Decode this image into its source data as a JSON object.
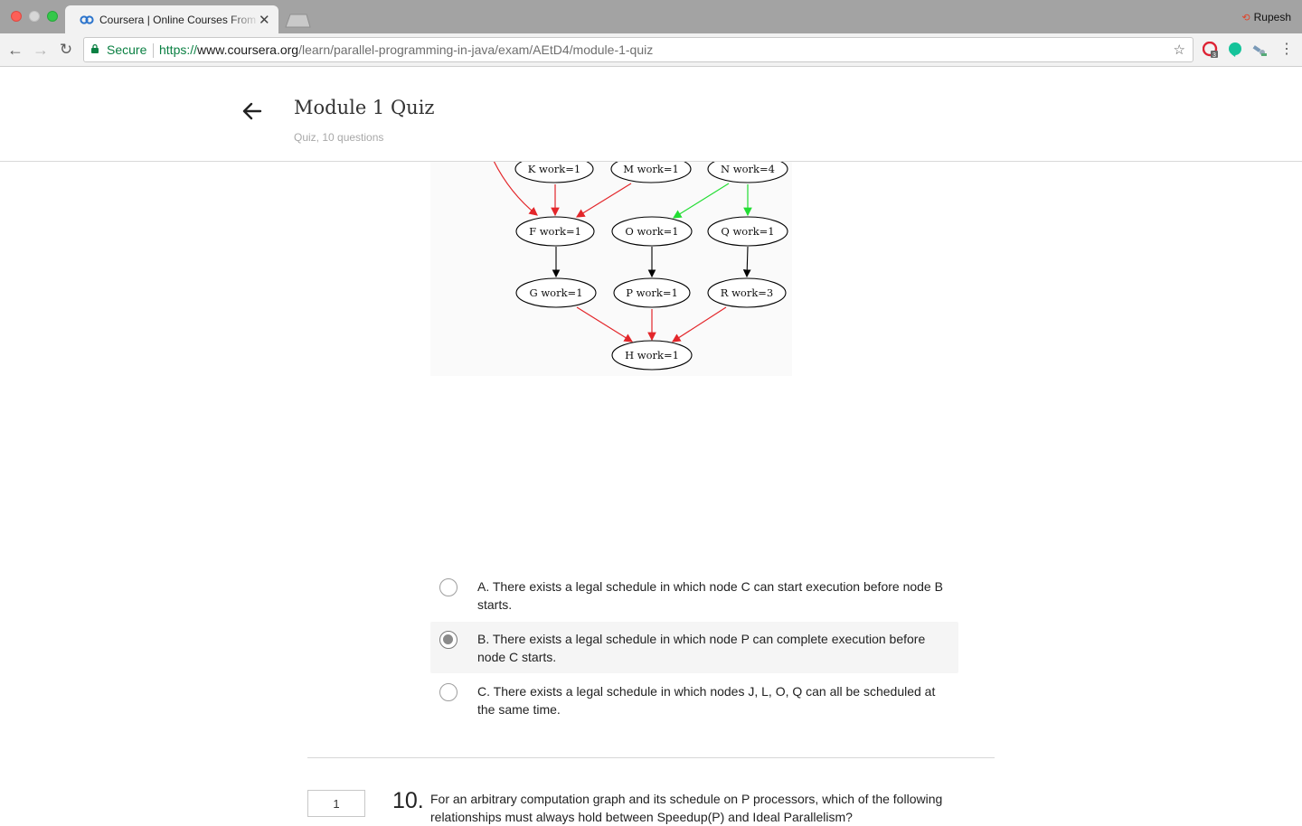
{
  "browser": {
    "tab_title": "Coursera | Online Courses From",
    "profile_name": "Rupesh",
    "secure_label": "Secure",
    "url_scheme": "https://",
    "url_host": "www.coursera.org",
    "url_path": "/learn/parallel-programming-in-java/exam/AEtD4/module-1-quiz",
    "extension_badge": "3",
    "icons": [
      "back-icon",
      "forward-icon",
      "reload-icon",
      "lock-icon",
      "star-icon",
      "menu-icon"
    ]
  },
  "header": {
    "title": "Module 1 Quiz",
    "subtitle": "Quiz, 10 questions"
  },
  "graph": {
    "nodes": {
      "k": "K work=1",
      "m": "M work=1",
      "n": "N work=4",
      "f": "F work=1",
      "o": "O work=1",
      "q": "Q work=1",
      "g": "G work=1",
      "p": "P work=1",
      "r": "R work=3",
      "h": "H work=1"
    },
    "edge_colors": {
      "critical": "#e3262a",
      "path": "#22dd33",
      "normal": "#000000"
    }
  },
  "question9": {
    "options": [
      {
        "label": "A. There exists a legal schedule in which node C can start execution before node B starts.",
        "selected": false
      },
      {
        "label": "B. There exists a legal schedule in which node P can complete execution before node C starts.",
        "selected": true
      },
      {
        "label": "C. There exists a legal schedule in which nodes J, L, O, Q can all be scheduled at the same time.",
        "selected": false
      }
    ]
  },
  "question10": {
    "points": "1",
    "number": "10.",
    "text": "For an arbitrary computation graph and its schedule on P processors, which of the following relationships must always hold between Speedup(P) and Ideal Parallelism?"
  }
}
